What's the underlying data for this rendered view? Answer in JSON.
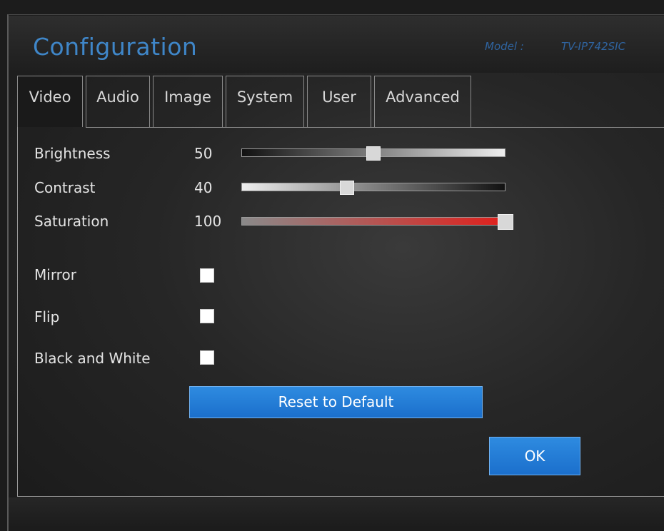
{
  "window": {
    "title": "Configuration",
    "model_label": "Model :",
    "model_value": "TV-IP742SIC"
  },
  "tabs": [
    {
      "label": "Video",
      "active": true
    },
    {
      "label": "Audio",
      "active": false
    },
    {
      "label": "Image",
      "active": false
    },
    {
      "label": "System",
      "active": false
    },
    {
      "label": "User",
      "active": false
    },
    {
      "label": "Advanced",
      "active": false
    }
  ],
  "sliders": [
    {
      "label": "Brightness",
      "value": "50",
      "level": 0.5
    },
    {
      "label": "Contrast",
      "value": "40",
      "level": 0.4
    },
    {
      "label": "Saturation",
      "value": "100",
      "level": 1.0
    }
  ],
  "checkboxes": [
    {
      "label": "Mirror",
      "checked": false
    },
    {
      "label": "Flip",
      "checked": false
    },
    {
      "label": "Black and White",
      "checked": false
    }
  ],
  "buttons": {
    "reset_label": "Reset to Default",
    "ok_label": "OK"
  },
  "colors": {
    "accent": "#3f86c8",
    "button": "#1b6fcc",
    "saturation": "#e0201c"
  }
}
